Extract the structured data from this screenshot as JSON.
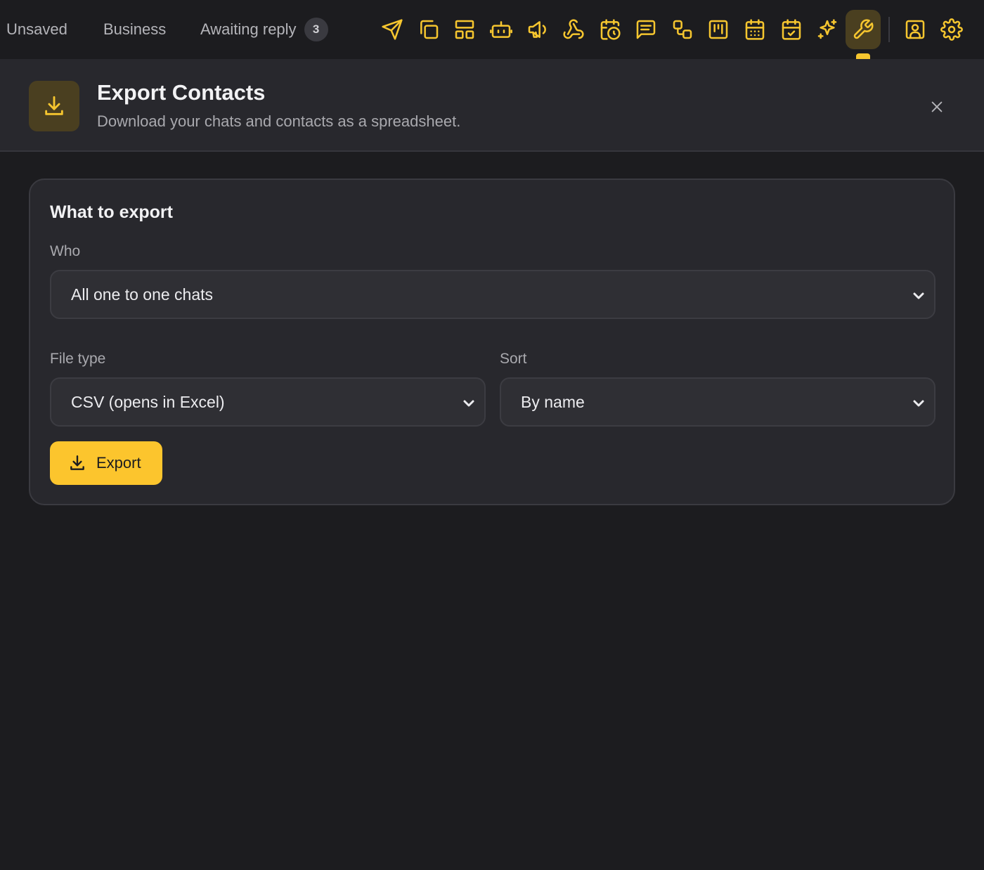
{
  "topbar": {
    "tabs": [
      {
        "label": "Unsaved"
      },
      {
        "label": "Business"
      },
      {
        "label": "Awaiting reply",
        "badge": "3"
      }
    ],
    "tools": [
      {
        "icon": "send-icon"
      },
      {
        "icon": "copy-icon"
      },
      {
        "icon": "layout-icon"
      },
      {
        "icon": "bot-icon"
      },
      {
        "icon": "megaphone-icon"
      },
      {
        "icon": "webhook-icon"
      },
      {
        "icon": "calendar-clock-icon"
      },
      {
        "icon": "message-square-icon"
      },
      {
        "icon": "workflow-icon"
      },
      {
        "icon": "kanban-icon"
      },
      {
        "icon": "calendar-grid-icon"
      },
      {
        "icon": "calendar-check-icon"
      },
      {
        "icon": "sparkles-icon"
      },
      {
        "icon": "wrench-icon",
        "active": true
      },
      {
        "icon": "contact-icon"
      },
      {
        "icon": "settings-icon"
      }
    ],
    "accent_color": "#f6c62f"
  },
  "header": {
    "title": "Export Contacts",
    "subtitle": "Download your chats and contacts as a spreadsheet.",
    "icon": "download-icon"
  },
  "card": {
    "title": "What to export",
    "who": {
      "label": "Who",
      "value": "All one to one chats"
    },
    "file_type": {
      "label": "File type",
      "value": "CSV (opens in Excel)"
    },
    "sort": {
      "label": "Sort",
      "value": "By name"
    },
    "export_button": "Export"
  }
}
